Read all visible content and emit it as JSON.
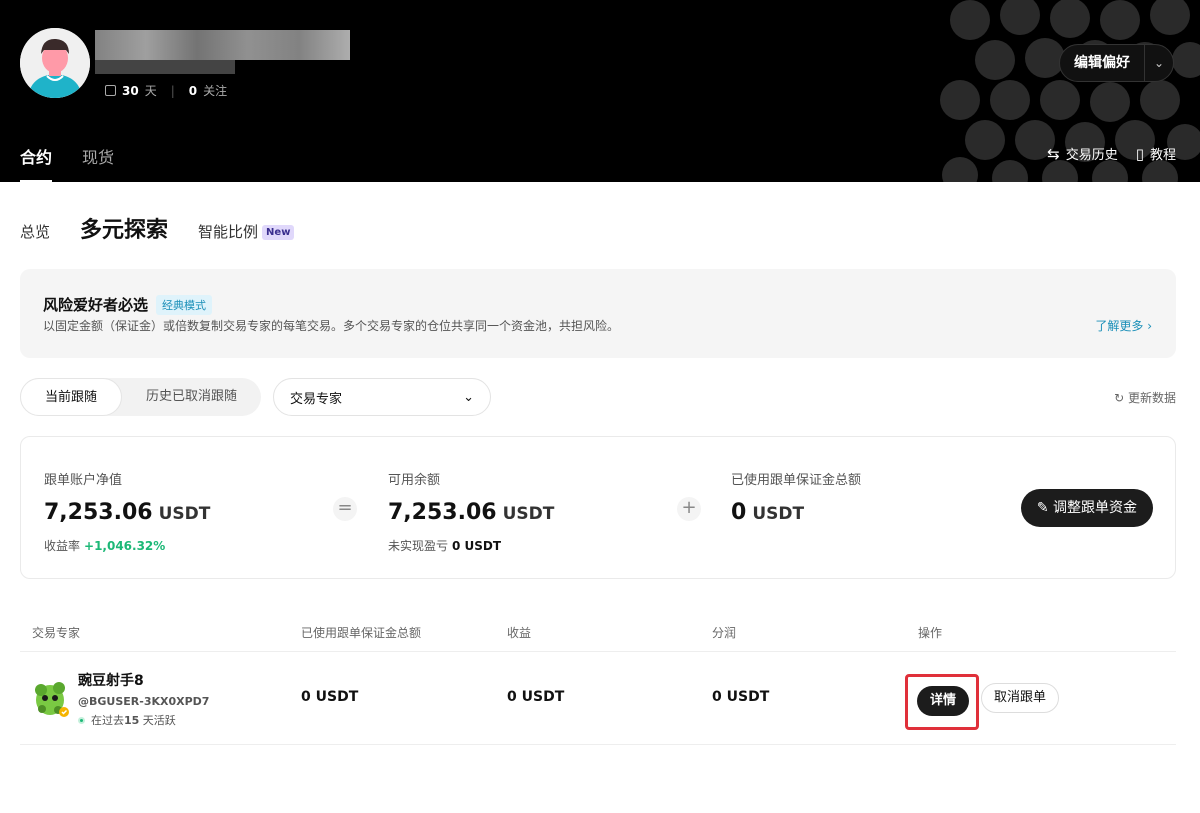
{
  "header": {
    "stats": {
      "days_value": "30",
      "days_unit": "天",
      "follow_value": "0",
      "follow_unit": "关注"
    },
    "edit_pref_label": "编辑偏好",
    "tabs": [
      {
        "label": "合约"
      },
      {
        "label": "现货"
      }
    ],
    "links": {
      "history": "交易历史",
      "tutorial": "教程"
    }
  },
  "subnav": {
    "overview": "总览",
    "explore": "多元探索",
    "smart": "智能比例",
    "new_badge": "New"
  },
  "banner": {
    "title": "风险爱好者必选",
    "tag": "经典模式",
    "desc": "以固定金额（保证金）或倍数复制交易专家的每笔交易。多个交易专家的仓位共享同一个资金池，共担风险。",
    "more": "了解更多 ›"
  },
  "filters": {
    "current": "当前跟随",
    "history": "历史已取消跟随",
    "select_value": "交易专家",
    "refresh": "更新数据"
  },
  "summary": {
    "net_label": "跟单账户净值",
    "net_value": "7,253.06",
    "net_unit": "USDT",
    "yield_label": "收益率",
    "yield_value": "+1,046.32%",
    "avail_label": "可用余额",
    "avail_value": "7,253.06",
    "avail_unit": "USDT",
    "unrealized_label": "未实现盈亏",
    "unrealized_value": "0 USDT",
    "margin_label": "已使用跟单保证金总额",
    "margin_value": "0",
    "margin_unit": "USDT",
    "adjust_label": "调整跟单资金",
    "op_equals": "=",
    "op_plus": "+"
  },
  "table": {
    "headers": [
      "交易专家",
      "已使用跟单保证金总额",
      "收益",
      "分润",
      "操作"
    ],
    "rows": [
      {
        "name": "豌豆射手8",
        "uid": "@BGUSER-3KX0XPD7",
        "active_prefix": "在过去",
        "active_days": "15",
        "active_suffix": " 天活跃",
        "margin": "0 USDT",
        "profit": "0 USDT",
        "share": "0 USDT",
        "details": "详情",
        "cancel": "取消跟单"
      }
    ]
  },
  "colors": {
    "accent_green": "#1db877",
    "accent_blue": "#1a8fb8",
    "highlight_red": "#e0303a"
  }
}
